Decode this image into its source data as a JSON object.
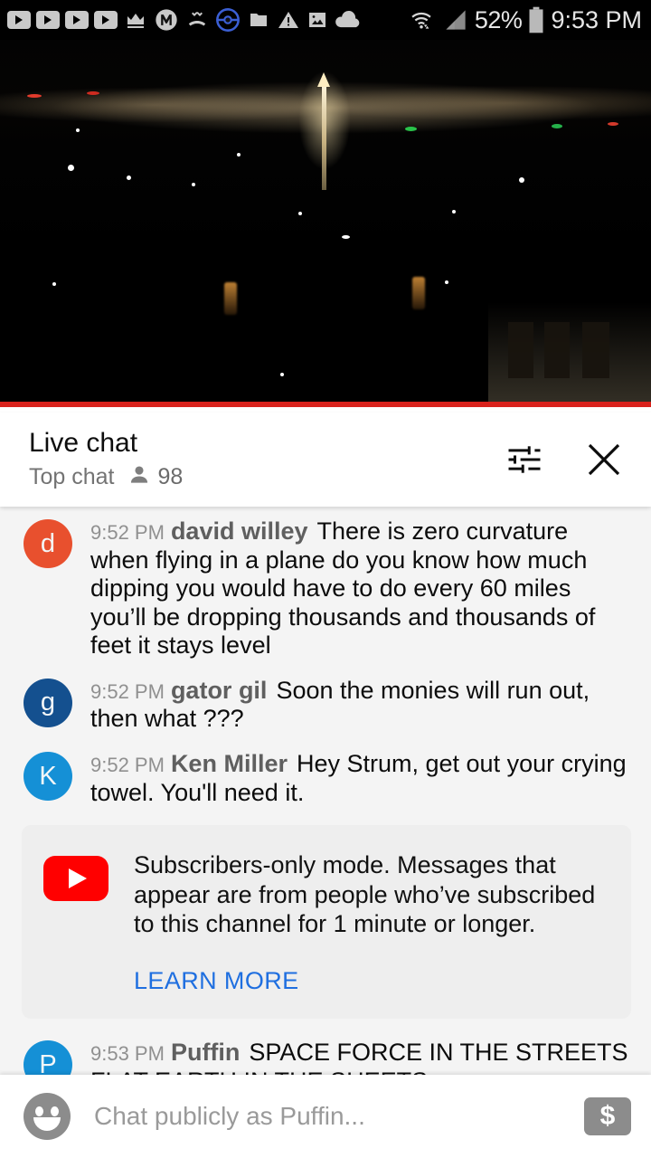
{
  "status_bar": {
    "icons": [
      "youtube-play-icon",
      "youtube-play-icon",
      "youtube-play-icon",
      "youtube-play-icon",
      "crown-icon",
      "m-circle-icon",
      "missed-call-icon",
      "pokeball-icon",
      "folder-icon",
      "warning-triangle-icon",
      "image-icon",
      "cloud-icon"
    ],
    "wifi_icon": "wifi-icon",
    "signal_icon": "cell-signal-icon",
    "battery_percent": "52%",
    "battery_icon": "battery-icon",
    "clock": "9:53 PM"
  },
  "video": {
    "name": "live-video-player",
    "progress_color": "#d9221c",
    "progress_percent": 100
  },
  "chat_header": {
    "title": "Live chat",
    "mode_label": "Top chat",
    "viewer_icon": "person-icon",
    "viewer_count": "98",
    "settings_icon": "tune-icon",
    "close_icon": "close-icon"
  },
  "messages": [
    {
      "avatar_letter": "d",
      "avatar_color": "#e8502e",
      "timestamp": "9:52 PM",
      "author": "david willey",
      "text": "There is zero curvature when flying in a plane do you know how much dipping you would have to do every 60 miles you’ll be dropping thousands and thousands of feet it stays level"
    },
    {
      "avatar_letter": "g",
      "avatar_color": "#14508f",
      "timestamp": "9:52 PM",
      "author": "gator gil",
      "text": "Soon the monies will run out, then what ???"
    },
    {
      "avatar_letter": "K",
      "avatar_color": "#1590d6",
      "timestamp": "9:52 PM",
      "author": "Ken Miller",
      "text": "Hey Strum, get out your crying towel. You'll need it."
    }
  ],
  "notice": {
    "logo_icon": "youtube-logo-icon",
    "text": "Subscribers-only mode. Messages that appear are from people who’ve subscribed to this channel for 1 minute or longer.",
    "learn_more_label": "LEARN MORE",
    "link_color": "#1f6fe0"
  },
  "messages_after_notice": [
    {
      "avatar_letter": "P",
      "avatar_color": "#1590d6",
      "timestamp": "9:53 PM",
      "author": "Puffin",
      "text": "SPACE FORCE IN THE STREETS FLAT EARTH IN THE SHEETS"
    }
  ],
  "input_bar": {
    "emoji_icon": "emoji-smiley-icon",
    "placeholder": "Chat publicly as Puffin...",
    "value": "",
    "superchat_icon": "dollar-icon",
    "superchat_symbol": "$"
  }
}
